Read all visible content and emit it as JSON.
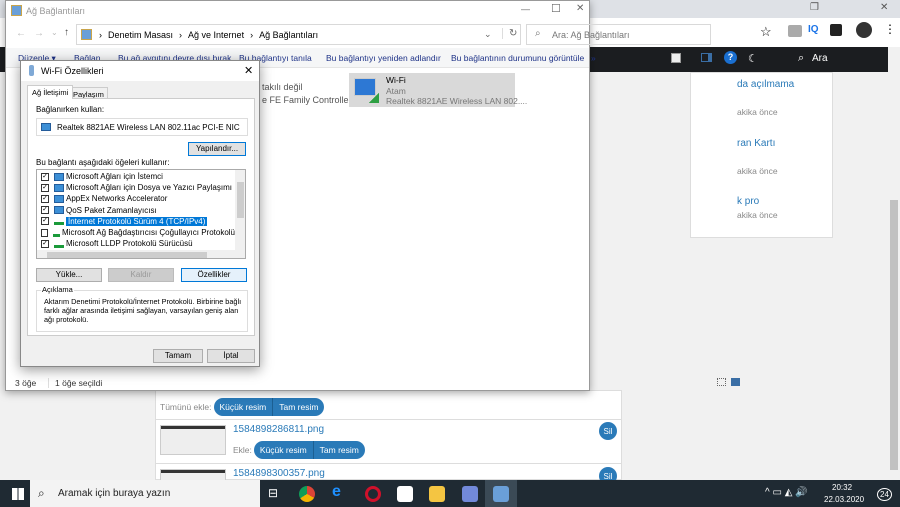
{
  "browser": {
    "search_label": "Ara",
    "ext_iq": "IQ",
    "right_items": [
      {
        "title": "da açılmama",
        "time": "akika önce"
      },
      {
        "title": "ran Kartı",
        "time": "akika önce"
      },
      {
        "title": "k pro",
        "time": "akika önce"
      }
    ],
    "add_all_label": "Tümünü ekle:",
    "small_image": "Küçük resim",
    "full_image": "Tam resim",
    "add_label": "Ekle:",
    "delete_label": "Sil",
    "files": [
      "1584898286811.png",
      "1584898300357.png"
    ]
  },
  "explorer": {
    "title": "Ağ Bağlantıları",
    "breadcrumb": [
      "Denetim Masası",
      "Ağ ve Internet",
      "Ağ Bağlantıları"
    ],
    "search_placeholder": "Ara: Ağ Bağlantıları",
    "toolbar": [
      "Düzenle ▾",
      "Bağlan",
      "Bu ağ aygıtını devre dışı bırak",
      "Bu bağlantıyı tanıla",
      "Bu bağlantıyı yeniden adlandır",
      "Bu bağlantının durumunu görüntüle",
      "»"
    ],
    "ethernet": {
      "status": "takılı değil",
      "adapter": "e FE Family Controller"
    },
    "wifi": {
      "name": "Wi-Fi",
      "network": "Atam",
      "adapter": "Realtek 8821AE Wireless LAN 802...."
    },
    "status": {
      "count": "3 öğe",
      "selected": "1 öğe seçildi"
    }
  },
  "dialog": {
    "title": "Wi-Fi Özellikleri",
    "tabs": [
      "Ağ İletişimi",
      "Paylaşım"
    ],
    "connect_using_label": "Bağlanırken kullan:",
    "adapter": "Realtek 8821AE Wireless LAN 802.11ac PCI-E NIC",
    "configure": "Yapılandır...",
    "items_label": "Bu bağlantı aşağıdaki öğeleri kullanır:",
    "items": [
      {
        "label": "Microsoft Ağları için İstemci",
        "checked": true,
        "icon": "network"
      },
      {
        "label": "Microsoft Ağları için Dosya ve Yazıcı Paylaşımı",
        "checked": true,
        "icon": "network"
      },
      {
        "label": "AppEx Networks Accelerator",
        "checked": true,
        "icon": "network"
      },
      {
        "label": "QoS Paket Zamanlayıcısı",
        "checked": true,
        "icon": "network"
      },
      {
        "label": "İnternet Protokolü Sürüm 4 (TCP/IPv4)",
        "checked": true,
        "icon": "protocol",
        "selected": true
      },
      {
        "label": "Microsoft Ağ Bağdaştırıcısı Çoğullayıcı Protokolü",
        "checked": false,
        "icon": "protocol"
      },
      {
        "label": "Microsoft LLDP Protokolü Sürücüsü",
        "checked": true,
        "icon": "protocol"
      }
    ],
    "install": "Yükle...",
    "uninstall": "Kaldır",
    "properties": "Özellikler",
    "description_label": "Açıklama",
    "description": "Aktarım Denetimi Protokolü/İnternet Protokolü. Birbirine bağlı farklı ağlar arasında iletişimi sağlayan, varsayılan geniş alan ağı protokolü.",
    "ok": "Tamam",
    "cancel": "İptal"
  },
  "taskbar": {
    "search_placeholder": "Aramak için buraya yazın",
    "time": "20:32",
    "date": "22.03.2020",
    "notifications": "24"
  }
}
